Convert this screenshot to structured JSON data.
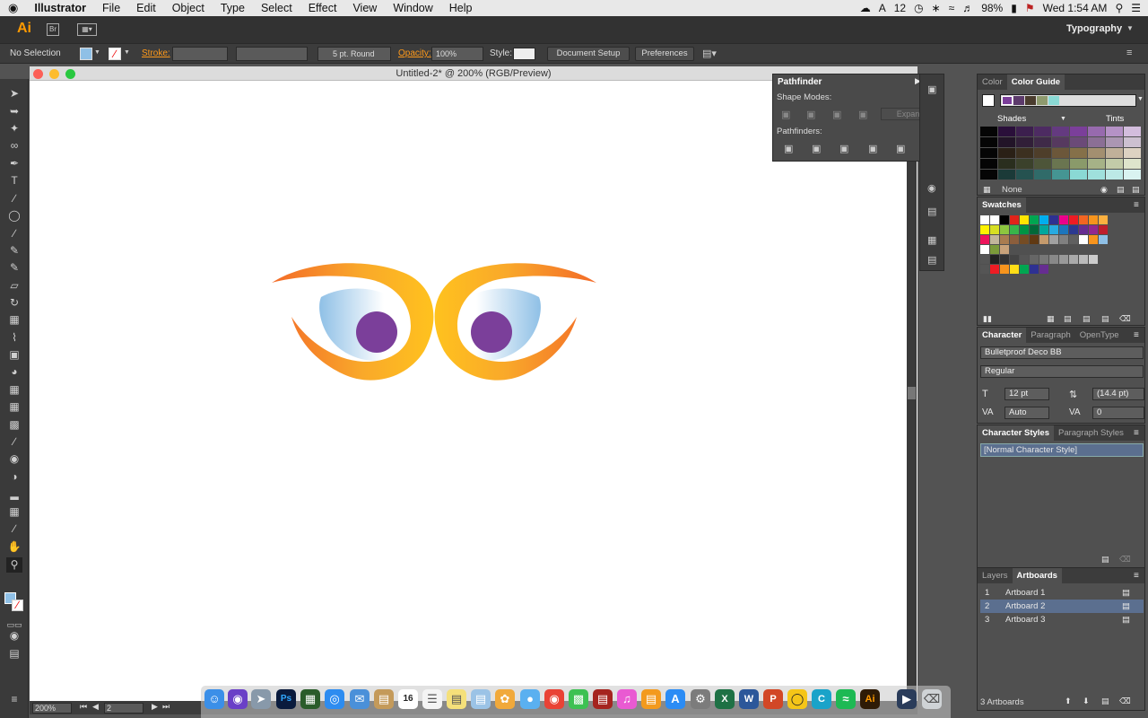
{
  "menubar": {
    "apple": "",
    "app_name": "Illustrator",
    "items": [
      "File",
      "Edit",
      "Object",
      "Type",
      "Select",
      "Effect",
      "View",
      "Window",
      "Help"
    ],
    "status": {
      "adobe_count": "12",
      "battery": "98%",
      "clock": "Wed 1:54 AM"
    }
  },
  "appbar": {
    "logo": "Ai",
    "workspace": "Typography"
  },
  "control_bar": {
    "selection": "No Selection",
    "stroke_label": "Stroke:",
    "brush": "5 pt. Round",
    "opacity_label": "Opacity:",
    "opacity_value": "100%",
    "style_label": "Style:",
    "document_setup": "Document Setup",
    "preferences": "Preferences"
  },
  "document": {
    "title": "Untitled-2* @ 200% (RGB/Preview)",
    "zoom": "200%",
    "artboard_nav": "2"
  },
  "pathfinder": {
    "title": "Pathfinder",
    "shape_modes": "Shape Modes:",
    "expand": "Expand",
    "pathfinders": "Pathfinders:"
  },
  "color_panel": {
    "tabs": [
      "Color",
      "Color Guide"
    ],
    "active_tab": "Color Guide",
    "shades": "Shades",
    "tints": "Tints",
    "none_label": "None"
  },
  "swatches_panel": {
    "title": "Swatches"
  },
  "character_panel": {
    "tabs": [
      "Character",
      "Paragraph",
      "OpenType"
    ],
    "font": "Bulletproof Deco BB",
    "style": "Regular",
    "size": "12 pt",
    "leading": "(14.4 pt)",
    "kerning": "Auto",
    "tracking": "0"
  },
  "styles_panel": {
    "tabs": [
      "Character Styles",
      "Paragraph Styles"
    ],
    "items": [
      "[Normal Character Style]"
    ]
  },
  "artboards_panel": {
    "tabs": [
      "Layers",
      "Artboards"
    ],
    "rows": [
      {
        "num": "1",
        "name": "Artboard 1"
      },
      {
        "num": "2",
        "name": "Artboard 2"
      },
      {
        "num": "3",
        "name": "Artboard 3"
      }
    ],
    "footer": "3 Artboards"
  },
  "colors": {
    "accent_orange": "#ff9a00",
    "purple": "#7b3f9a",
    "selected_row": "#5b6f8f"
  }
}
